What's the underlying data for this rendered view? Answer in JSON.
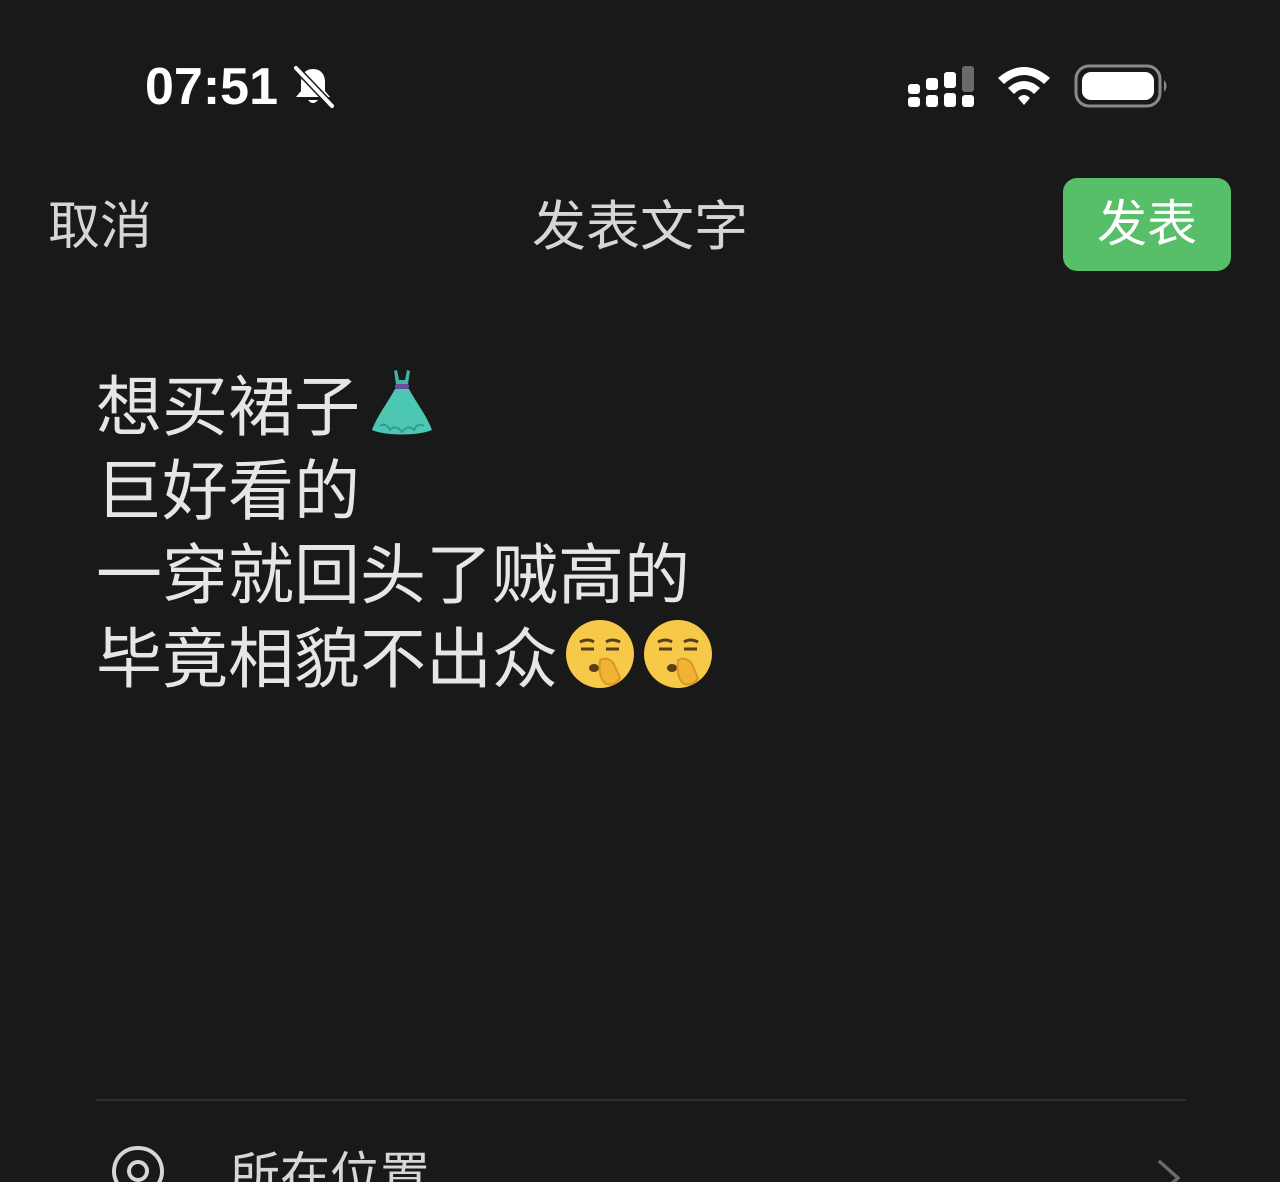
{
  "status_bar": {
    "time": "07:51",
    "icons": [
      "bell-slash-icon",
      "cellular-signal-icon",
      "wifi-icon",
      "battery-icon"
    ]
  },
  "nav": {
    "cancel_label": "取消",
    "title": "发表文字",
    "post_label": "发表"
  },
  "colors": {
    "background": "#191919",
    "accent": "#57be6a",
    "text": "#e6e6e6"
  },
  "compose": {
    "lines": [
      "想买裙子",
      "巨好看的",
      "一穿就回头了贼高的",
      "毕竟相貌不出众"
    ],
    "line1_emoji": "dress-emoji",
    "line4_emojis": [
      "shushing-face-emoji",
      "shushing-face-emoji"
    ]
  },
  "location": {
    "label": "所在位置",
    "icon": "location-pin-icon"
  }
}
